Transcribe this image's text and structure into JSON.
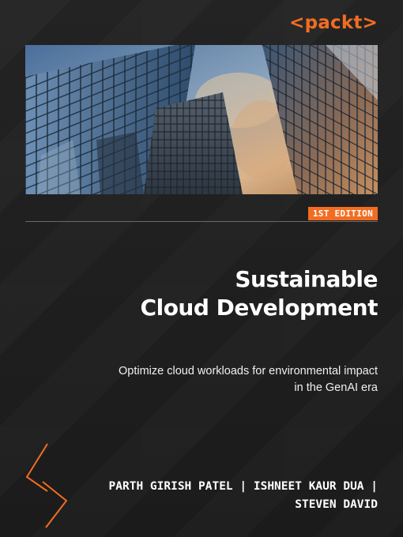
{
  "brand": {
    "logo_text": "<packt>",
    "accent": "#f26d21"
  },
  "cover": {
    "edition": "1ST EDITION",
    "title_line1": "Sustainable",
    "title_line2": "Cloud Development",
    "subtitle_line1": "Optimize cloud workloads for environmental impact",
    "subtitle_line2": "in the GenAI era",
    "authors_line1": "PARTH GIRISH PATEL | ISHNEET KAUR DUA |",
    "authors_line2": "STEVEN DAVID"
  },
  "photo": {
    "subject": "glass-skyscrapers-image"
  },
  "colors": {
    "background": "#1e1e1e",
    "text": "#ffffff"
  }
}
